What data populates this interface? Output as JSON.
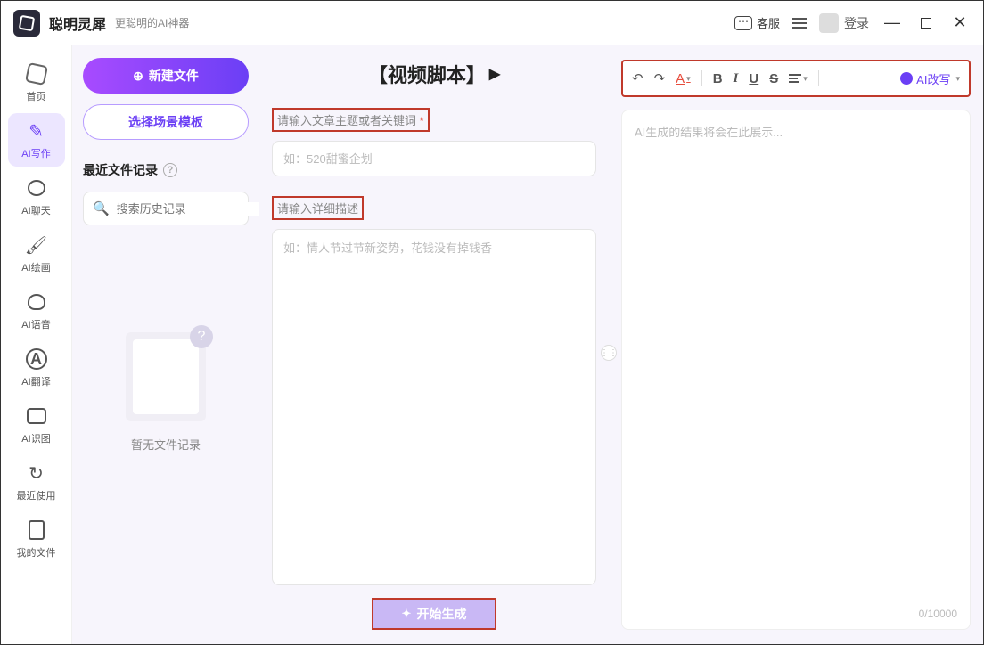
{
  "app": {
    "name": "聪明灵犀",
    "subtitle": "更聪明的AI神器"
  },
  "titlebar": {
    "kefu": "客服",
    "login": "登录"
  },
  "sidebar": {
    "items": [
      {
        "label": "首页"
      },
      {
        "label": "AI写作"
      },
      {
        "label": "AI聊天"
      },
      {
        "label": "AI绘画"
      },
      {
        "label": "AI语音"
      },
      {
        "label": "AI翻译"
      },
      {
        "label": "AI识图"
      },
      {
        "label": "最近使用"
      },
      {
        "label": "我的文件"
      }
    ],
    "active_index": 1
  },
  "panel2": {
    "new_file": "新建文件",
    "select_template": "选择场景模板",
    "recent_header": "最近文件记录",
    "search_placeholder": "搜索历史记录",
    "empty_text": "暂无文件记录"
  },
  "center": {
    "title": "【视频脚本】",
    "label1": "请输入文章主题或者关键词",
    "input_placeholder": "如：520甜蜜企划",
    "label2": "请输入详细描述",
    "textarea_placeholder": "如：情人节过节新姿势，花钱没有掉钱香",
    "generate": "开始生成"
  },
  "right": {
    "toolbar": {
      "undo": "↶",
      "redo": "↷",
      "font": "A",
      "bold": "B",
      "italic": "I",
      "underline": "U",
      "strike": "S",
      "ai_rewrite": "AI改写"
    },
    "output_placeholder": "AI生成的结果将会在此展示...",
    "counter": "0/10000"
  }
}
